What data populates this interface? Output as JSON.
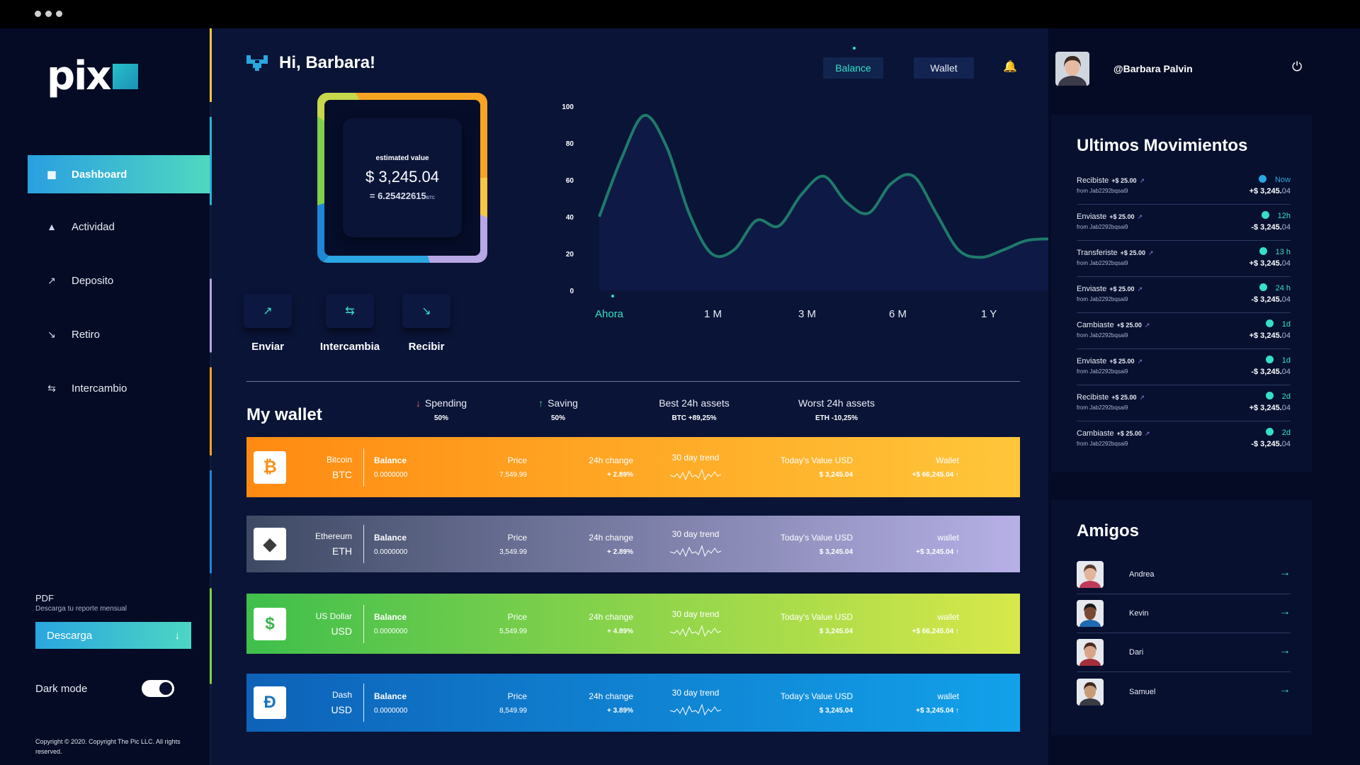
{
  "brand": {
    "logo_text": "pix"
  },
  "nav": [
    {
      "label": "Dashboard",
      "icon": "dashboard-icon",
      "glyph": "▦"
    },
    {
      "label": "Actividad",
      "icon": "activity-icon",
      "glyph": "▲"
    },
    {
      "label": "Deposito",
      "icon": "deposit-icon",
      "glyph": "↗"
    },
    {
      "label": "Retiro",
      "icon": "withdraw-icon",
      "glyph": "↘"
    },
    {
      "label": "Intercambio",
      "icon": "exchange-icon",
      "glyph": "⇆"
    }
  ],
  "pdf": {
    "title": "PDF",
    "subtitle": "Descarga tu reporte mensual",
    "button": "Descarga"
  },
  "dark_mode": {
    "label": "Dark mode",
    "enabled": true
  },
  "copyright": "Copyright © 2020. Copyright The Pic LLC. All rights reserved.",
  "header": {
    "greeting": "Hi, Barbara!",
    "tabs": [
      "Balance",
      "Wallet"
    ],
    "active_tab": "Balance"
  },
  "profile": {
    "name": "@Barbara Palvin"
  },
  "balance_card": {
    "label": "estimated value",
    "value": "$ 3,245.04",
    "btc": "= 6.25422615",
    "btc_unit": "BTC"
  },
  "actions": [
    {
      "label": "Enviar",
      "glyph": "↗",
      "icon": "send-icon"
    },
    {
      "label": "Intercambia",
      "glyph": "⇆",
      "icon": "swap-icon"
    },
    {
      "label": "Recibir",
      "glyph": "↘",
      "icon": "receive-icon"
    }
  ],
  "chart_data": {
    "type": "area",
    "y_ticks": [
      "100",
      "80",
      "60",
      "40",
      "20",
      "0"
    ],
    "ylim": [
      0,
      100
    ],
    "x": [
      0,
      1,
      2,
      3,
      4,
      5,
      6,
      7,
      8,
      9,
      10,
      11,
      12,
      13,
      14,
      15,
      16,
      17,
      18,
      19,
      20
    ],
    "values": [
      40,
      72,
      95,
      78,
      42,
      20,
      22,
      38,
      35,
      52,
      62,
      48,
      42,
      58,
      62,
      42,
      22,
      18,
      22,
      27,
      28
    ],
    "range_tabs": [
      "Ahora",
      "1 M",
      "3 M",
      "6 M",
      "1 Y"
    ],
    "active_range": "Ahora",
    "line_color": "#1f7a6a"
  },
  "wallet": {
    "title": "My wallet",
    "stats": [
      {
        "label": "Spending",
        "value": "50%",
        "arrow": "↓"
      },
      {
        "label": "Saving",
        "value": "50%",
        "arrow": "↑"
      },
      {
        "label": "Best 24h assets",
        "value": "BTC +89,25%"
      },
      {
        "label": "Worst 24h assets",
        "value": "ETH -10,25%"
      }
    ],
    "assets": [
      {
        "name": "Bitcoin",
        "symbol": "BTC",
        "glyph": "₿",
        "glyph_color": "#f7931a",
        "balance_label": "Balance",
        "balance": "0.0000000",
        "price_label": "Price",
        "price": "7,549.99",
        "change_label": "24h change",
        "change": "+ 2.89%",
        "trend_label": "30 day trend",
        "value_label": "Today's Value USD",
        "value": "$ 3,245.04",
        "wallet_label": "Wallet",
        "wallet": "+$ 66,245.04 ↑"
      },
      {
        "name": "Ethereum",
        "symbol": "ETH",
        "glyph": "◆",
        "glyph_color": "#3c3c3d",
        "balance_label": "Balance",
        "balance": "0.0000000",
        "price_label": "Price",
        "price": "3,549.99",
        "change_label": "24h change",
        "change": "+ 2.89%",
        "trend_label": "30 day trend",
        "value_label": "Today's Value USD",
        "value": "$ 3,245.04",
        "wallet_label": "wallet",
        "wallet": "+$ 3,245.04 ↑"
      },
      {
        "name": "US Dollar",
        "symbol": "USD",
        "glyph": "$",
        "glyph_color": "#3ab54a",
        "balance_label": "Balance",
        "balance": "0.0000000",
        "price_label": "Price",
        "price": "5,549.99",
        "change_label": "24h change",
        "change": "+ 4.89%",
        "trend_label": "30 day trend",
        "value_label": "Today's Value USD",
        "value": "$ 3,245.04",
        "wallet_label": "wallet",
        "wallet": "+$ 66,245.04 ↑"
      },
      {
        "name": "Dash",
        "symbol": "USD",
        "glyph": "Đ",
        "glyph_color": "#1c75bc",
        "balance_label": "Balance",
        "balance": "0.0000000",
        "price_label": "Price",
        "price": "8,549.99",
        "change_label": "24h change",
        "change": "+ 3.89%",
        "trend_label": "30 day trend",
        "value_label": "Today's Value USD",
        "value": "$ 3,245.04",
        "wallet_label": "wallet",
        "wallet": "+$ 3,245.04 ↑"
      }
    ]
  },
  "movements": {
    "title": "Ultimos Movimientos",
    "items": [
      {
        "type": "Recibiste",
        "amount": "+$ 25.00",
        "from": "from Jab2292bqsai9",
        "time": "Now",
        "total": "+$ 3,245.",
        "cents": "04"
      },
      {
        "type": "Enviaste",
        "amount": "+$ 25.00",
        "from": "from Jab2292bqsai9",
        "time": "12h",
        "total": "-$ 3,245.",
        "cents": "04"
      },
      {
        "type": "Transferiste",
        "amount": "+$ 25.00",
        "from": "from Jab2292bqsai9",
        "time": "13 h",
        "total": "+$ 3,245.",
        "cents": "04"
      },
      {
        "type": "Enviaste",
        "amount": "+$ 25.00",
        "from": "from Jab2292bqsai9",
        "time": "24 h",
        "total": "-$ 3,245.",
        "cents": "04"
      },
      {
        "type": "Cambiaste",
        "amount": "+$ 25.00",
        "from": "from Jab2292bqsai9",
        "time": "1d",
        "total": "+$ 3,245.",
        "cents": "04"
      },
      {
        "type": "Enviaste",
        "amount": "+$ 25.00",
        "from": "from Jab2292bqsai9",
        "time": "1d",
        "total": "-$ 3,245.",
        "cents": "04"
      },
      {
        "type": "Recibiste",
        "amount": "+$ 25.00",
        "from": "from Jab2292bqsai9",
        "time": "2d",
        "total": "+$ 3,245.",
        "cents": "04"
      },
      {
        "type": "Cambiaste",
        "amount": "+$ 25.00",
        "from": "from Jab2292bqsai9",
        "time": "2d",
        "total": "-$ 3,245.",
        "cents": "04"
      }
    ]
  },
  "friends": {
    "title": "Amigos",
    "items": [
      {
        "name": "Andrea"
      },
      {
        "name": "Kevin"
      },
      {
        "name": "Dari"
      },
      {
        "name": "Samuel"
      }
    ]
  }
}
